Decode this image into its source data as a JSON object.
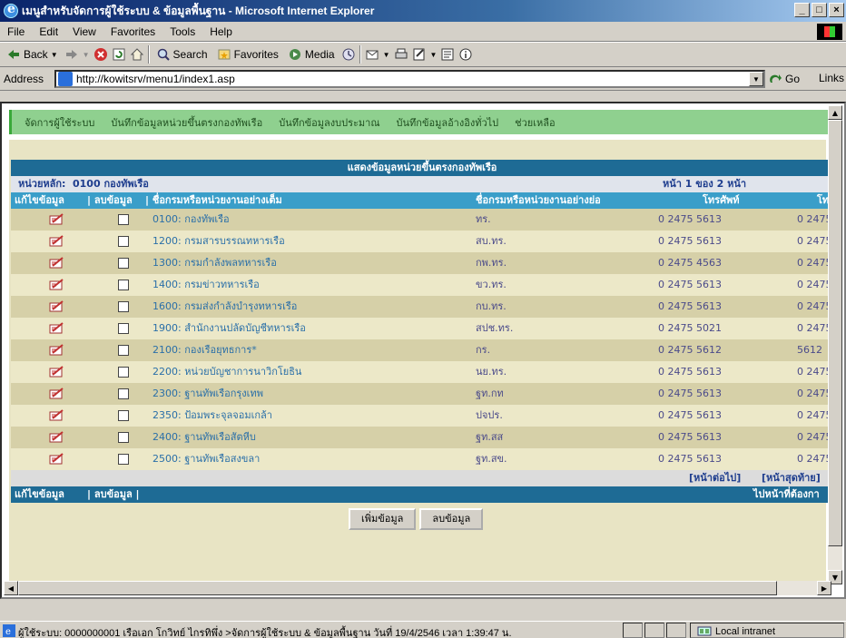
{
  "window": {
    "title": "เมนูสำหรับจัดการผู้ใช้ระบบ & ข้อมูลพื้นฐาน - Microsoft Internet Explorer",
    "min": "_",
    "max": "□",
    "close": "×"
  },
  "menu": [
    "File",
    "Edit",
    "View",
    "Favorites",
    "Tools",
    "Help"
  ],
  "toolbar": {
    "back": "Back",
    "search": "Search",
    "favorites": "Favorites",
    "media": "Media"
  },
  "address": {
    "label": "Address",
    "url": "http://kowitsrv/menu1/index1.asp",
    "go": "Go",
    "links": "Links"
  },
  "nav": [
    "จัดการผู้ใช้ระบบ",
    "บันทึกข้อมูลหน่วยขึ้นตรงกองทัพเรือ",
    "บันทึกข้อมูลงบประมาณ",
    "บันทึกข้อมูลอ้างอิงทั่วไป",
    "ช่วยเหลือ"
  ],
  "panel": {
    "title": "แสดงข้อมูลหน่วยขึ้นตรงกองทัพเรือ",
    "unit_label": "หน่วยหลัก:",
    "unit_value": "0100 กองทัพเรือ",
    "page_info": "หน้า  1  ของ  2  หน้า"
  },
  "columns": {
    "edit": "แก้ไขข้อมูล",
    "delete": "| ลบข้อมูล",
    "fullname": "| ชื่อกรมหรือหน่วยงานอย่างเต็ม",
    "shortname": "ชื่อกรมหรือหน่วยงานอย่างย่อ",
    "phone": "โทรศัพท์",
    "fax": "โท"
  },
  "rows": [
    {
      "name": "0100: กองทัพเรือ",
      "short": "ทร.",
      "phone": "0 2475 5613",
      "fax": "0 2475"
    },
    {
      "name": "1200: กรมสารบรรณทหารเรือ",
      "short": "สบ.ทร.",
      "phone": "0 2475 5613",
      "fax": "0 2475"
    },
    {
      "name": "1300: กรมกำลังพลทหารเรือ",
      "short": "กพ.ทร.",
      "phone": "0 2475 4563",
      "fax": "0 2475"
    },
    {
      "name": "1400: กรมข่าวทหารเรือ",
      "short": "ขว.ทร.",
      "phone": "0 2475 5613",
      "fax": "0 2475"
    },
    {
      "name": "1600: กรมส่งกำลังบำรุงทหารเรือ",
      "short": "กบ.ทร.",
      "phone": "0 2475 5613",
      "fax": "0 2475"
    },
    {
      "name": "1900: สำนักงานปลัดบัญชีทหารเรือ",
      "short": "สปช.ทร.",
      "phone": "0 2475 5021",
      "fax": "0 2475"
    },
    {
      "name": "2100: กองเรือยุทธการ*",
      "short": "กร.",
      "phone": "0 2475 5612",
      "fax": "5612"
    },
    {
      "name": "2200: หน่วยบัญชาการนาวิกโยธิน",
      "short": "นย.ทร.",
      "phone": "0 2475 5613",
      "fax": "0 2475"
    },
    {
      "name": "2300: ฐานทัพเรือกรุงเทพ",
      "short": "ฐท.กท",
      "phone": "0 2475 5613",
      "fax": "0 2475"
    },
    {
      "name": "2350: ป้อมพระจุลจอมเกล้า",
      "short": "ปจปร.",
      "phone": "0 2475 5613",
      "fax": "0 2475"
    },
    {
      "name": "2400: ฐานทัพเรือสัตหีบ",
      "short": "ฐท.สส",
      "phone": "0 2475 5613",
      "fax": "0 2475"
    },
    {
      "name": "2500: ฐานทัพเรือสงขลา",
      "short": "ฐท.สข.",
      "phone": "0 2475 5613",
      "fax": "0 2475"
    }
  ],
  "pager": {
    "next": "[หน้าต่อไป]",
    "last": "[หน้าสุดท้าย]"
  },
  "footer": {
    "edit": "แก้ไขข้อมูล",
    "delete": "| ลบข้อมูล |",
    "goto": "ไปหน้าที่ต้องกา"
  },
  "buttons": {
    "add": "เพิ่มข้อมูล",
    "delete": "ลบข้อมูล"
  },
  "status": {
    "text": "ผู้ใช้ระบบ: 0000000001 เรือเอก โกวิทย์ ไกรทิพึ่ง >จัดการผู้ใช้ระบบ & ข้อมูลพื้นฐาน วันที่ 19/4/2546 เวลา 1:39:47 น.",
    "zone": "Local intranet"
  }
}
